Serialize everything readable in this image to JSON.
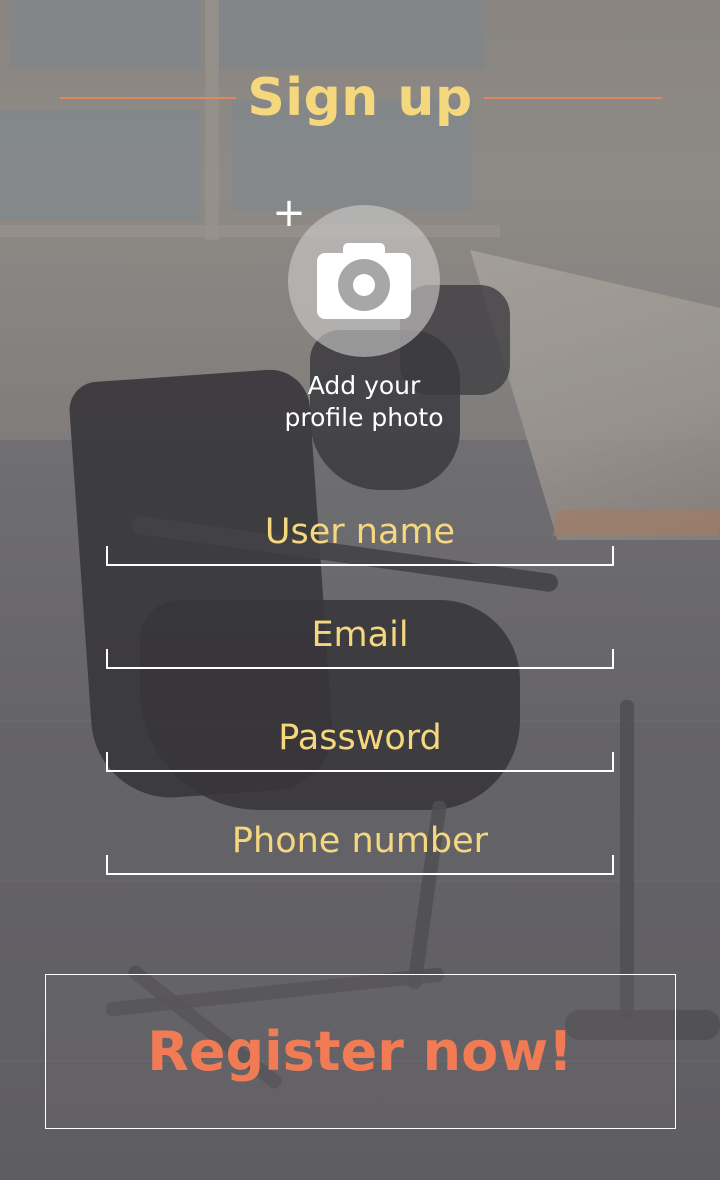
{
  "header": {
    "title": "Sign up"
  },
  "profile_photo": {
    "add_icon": "plus-icon",
    "camera_icon": "camera-icon",
    "label_line1": "Add your",
    "label_line2": "profile photo"
  },
  "form": {
    "fields": [
      {
        "label": "User name"
      },
      {
        "label": "Email"
      },
      {
        "label": "Password"
      },
      {
        "label": "Phone number"
      }
    ]
  },
  "register": {
    "label": "Register now!"
  },
  "colors": {
    "title": "#f5d77e",
    "accent_line": "#e0875f",
    "field_label": "#f5d77e",
    "register_text": "#f07b54"
  }
}
